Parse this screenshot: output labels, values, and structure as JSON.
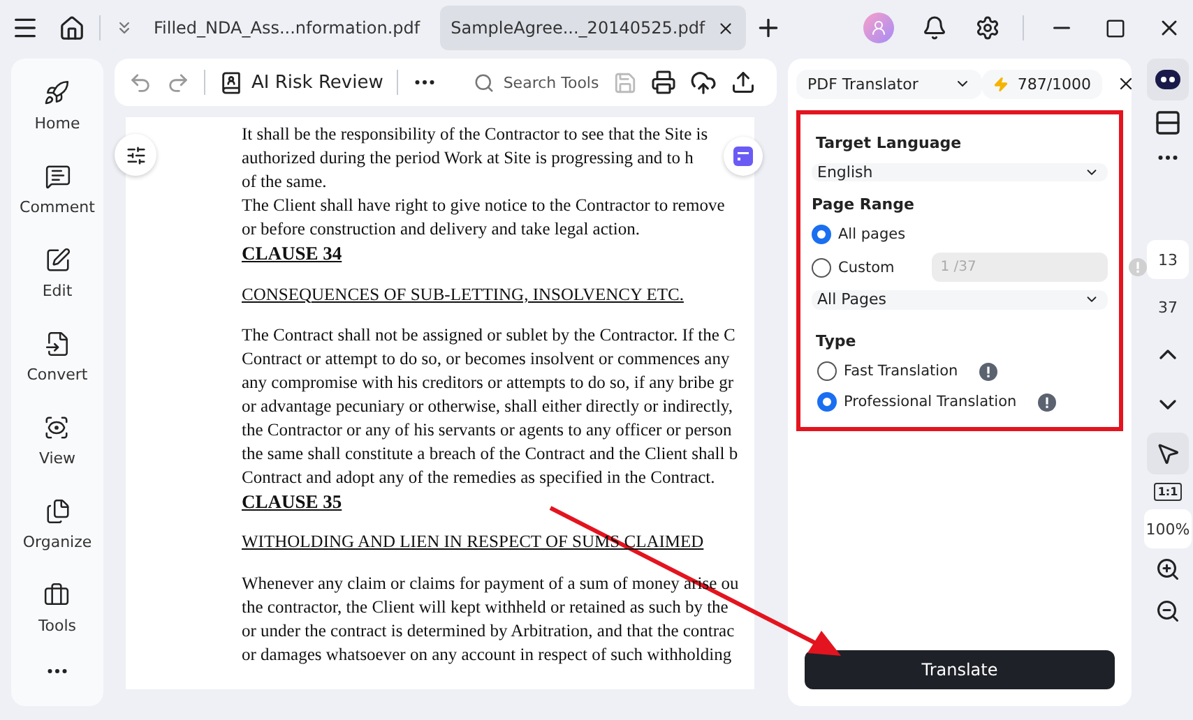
{
  "tabs": [
    {
      "label": "Filled_NDA_Ass...nformation.pdf",
      "selected": false
    },
    {
      "label": "SampleAgree..._20140525.pdf",
      "selected": true
    }
  ],
  "toolbar": {
    "ai_review": "AI Risk Review",
    "search": "Search Tools",
    "save_disabled": true
  },
  "sidebar": {
    "items": [
      {
        "kind": "rocket",
        "label": "Home"
      },
      {
        "kind": "comment",
        "label": "Comment"
      },
      {
        "kind": "edit",
        "label": "Edit"
      },
      {
        "kind": "convert",
        "label": "Convert"
      },
      {
        "kind": "view",
        "label": "View"
      },
      {
        "kind": "organize",
        "label": "Organize"
      },
      {
        "kind": "tools",
        "label": "Tools"
      }
    ]
  },
  "document": {
    "blocks": [
      {
        "kind": "text",
        "lines": [
          "It shall be the responsibility of the Contractor to see that the Site is",
          "authorized during the period Work at Site is progressing and to h",
          "of the same.",
          "The Client shall have right to give notice to the Contractor to remove",
          "or before construction and delivery and take legal action."
        ]
      },
      {
        "kind": "clause",
        "lines": [
          "CLAUSE 34"
        ]
      },
      {
        "kind": "heading",
        "lines": [
          "CONSEQUENCES OF SUB-LETTING, INSOLVENCY ETC."
        ]
      },
      {
        "kind": "text",
        "lines": [
          "The Contract shall not be assigned or sublet by the Contractor. If the C",
          "Contract or attempt to do so, or becomes insolvent or commences any",
          "any compromise with his creditors or attempts to do so, if any bribe gr",
          "or advantage pecuniary or otherwise, shall either directly or indirectly,",
          "the Contractor or any of his servants or agents to any officer or person",
          "the same shall constitute a breach of the Contract and the Client shall b",
          "Contract and adopt any of the remedies as specified in the Contract."
        ]
      },
      {
        "kind": "clause",
        "lines": [
          "CLAUSE 35"
        ]
      },
      {
        "kind": "heading",
        "lines": [
          "WITHOLDING AND LIEN IN RESPECT OF SUMS CLAIMED"
        ]
      },
      {
        "kind": "text",
        "lines": [
          "Whenever any claim or claims for payment of a sum of money arise ou",
          "the contractor, the Client will kept withheld or retained as such by the",
          "or under the contract is determined by Arbitration, and that the contrac",
          "or damages whatsoever on any account in respect of such withholding"
        ]
      }
    ]
  },
  "translator": {
    "title": "PDF Translator",
    "credits": "787/1000",
    "target_language": {
      "label": "Target Language",
      "value": "English"
    },
    "page_range": {
      "label": "Page Range",
      "options": [
        {
          "label": "All pages",
          "selected": true
        },
        {
          "label": "Custom",
          "selected": false
        }
      ],
      "custom_field": {
        "placeholder": "1 /37",
        "disabled": true
      },
      "pages_select": "All Pages"
    },
    "type": {
      "label": "Type",
      "options": [
        {
          "label": "Fast Translation",
          "selected": false
        },
        {
          "label": "Professional Translation",
          "selected": true
        }
      ]
    },
    "button": "Translate"
  },
  "right_rail": {
    "current_page": "13",
    "total_pages": "37",
    "actual_size": "1:1",
    "zoom": "100%"
  }
}
